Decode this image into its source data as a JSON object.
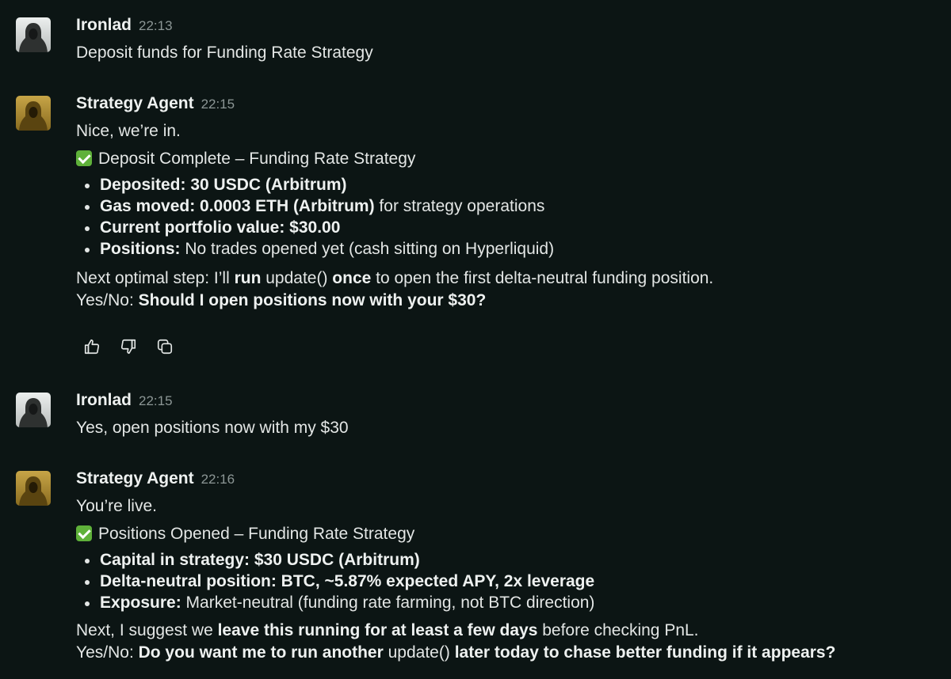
{
  "messages": [
    {
      "author": "Ironlad",
      "time": "22:13",
      "text": "Deposit funds for Funding Rate Strategy"
    },
    {
      "author": "Strategy Agent",
      "time": "22:15",
      "intro": "Nice, we’re in.",
      "status_title": "Deposit Complete – Funding Rate Strategy",
      "bullets": [
        {
          "bold": "Deposited: 30 USDC (Arbitrum)",
          "rest": ""
        },
        {
          "bold": "Gas moved: 0.0003 ETH (Arbitrum)",
          "rest": " for strategy operations"
        },
        {
          "bold": "Current portfolio value: $30.00",
          "rest": ""
        },
        {
          "bold": "Positions:",
          "rest": " No trades opened yet (cash sitting on Hyperliquid)"
        }
      ],
      "next_step": {
        "p1": "Next optimal step: I’ll ",
        "b1": "run",
        "p2": " update() ",
        "b2": "once",
        "p3": " to open the first delta-neutral funding position."
      },
      "question": {
        "prefix": "Yes/No: ",
        "bold": "Should I open positions now with your $30?"
      }
    },
    {
      "author": "Ironlad",
      "time": "22:15",
      "text": "Yes, open positions now with my $30"
    },
    {
      "author": "Strategy Agent",
      "time": "22:16",
      "intro": "You’re live.",
      "status_title": "Positions Opened – Funding Rate Strategy",
      "bullets": [
        {
          "bold": "Capital in strategy: $30 USDC (Arbitrum)",
          "rest": ""
        },
        {
          "bold": "Delta-neutral position: BTC, ~5.87% expected APY, 2x leverage",
          "rest": ""
        },
        {
          "bold": "Exposure:",
          "rest": " Market-neutral (funding rate farming, not BTC direction)"
        }
      ],
      "next_step": {
        "p1": "Next, I suggest we ",
        "b1": "leave this running for at least a few days",
        "p2": " before checking PnL."
      },
      "question": {
        "prefix": "Yes/No: ",
        "bold1": "Do you want me to run another",
        "plain": " update() ",
        "bold2": "later today to chase better funding if it appears?"
      }
    }
  ],
  "actions": {
    "icons": [
      "thumbs-up-icon",
      "thumbs-down-icon",
      "copy-icon"
    ]
  },
  "colors": {
    "background": "#0c1514",
    "text": "#e3e6e5",
    "timestamp": "#8c9695",
    "check": "#5fb13a"
  }
}
